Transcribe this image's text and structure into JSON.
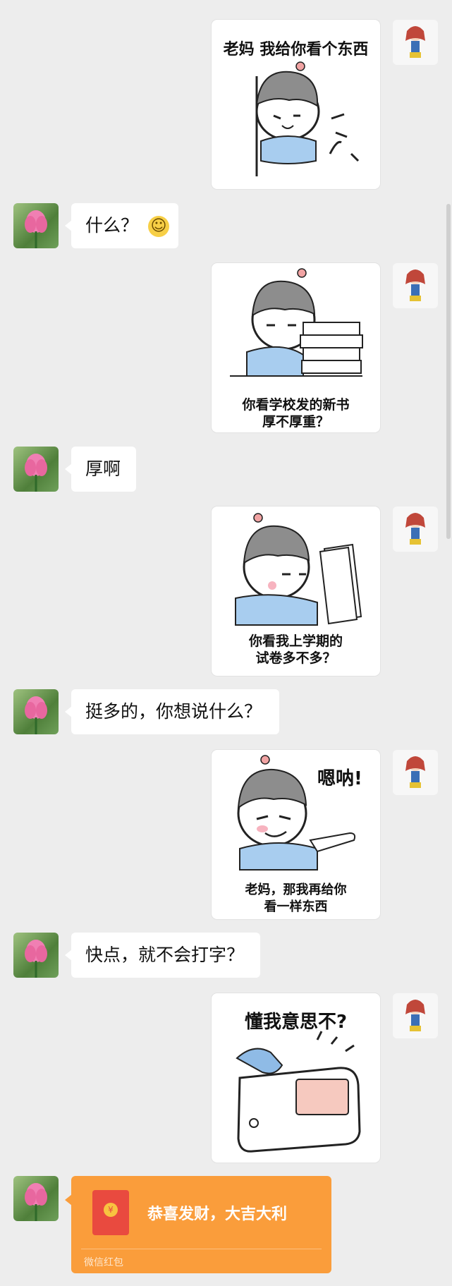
{
  "messages": [
    {
      "sticker_caption_1": "老妈 我给你看个东西"
    },
    {
      "text": "什么？"
    },
    {
      "sticker_caption_1": "你看学校发的新书",
      "sticker_caption_2": "厚不厚重？"
    },
    {
      "text": "厚啊"
    },
    {
      "sticker_caption_1": "你看我上学期的",
      "sticker_caption_2": "试卷多不多？"
    },
    {
      "text": "挺多的，你想说什么？"
    },
    {
      "sticker_shout": "嗯呐!",
      "sticker_caption_1": "老妈，那我再给你",
      "sticker_caption_2": "看一样东西"
    },
    {
      "text": "快点，就不会打字？"
    },
    {
      "sticker_caption_1": "懂我意思不?"
    }
  ],
  "red_packet": {
    "title": "恭喜发财，大吉大利",
    "footer": "微信红包",
    "coin_symbol": "¥"
  },
  "emoji": {
    "smile": "☺"
  },
  "colors": {
    "background": "#ededed",
    "red_packet": "#fa9d3b",
    "envelope": "#e94a3f"
  }
}
